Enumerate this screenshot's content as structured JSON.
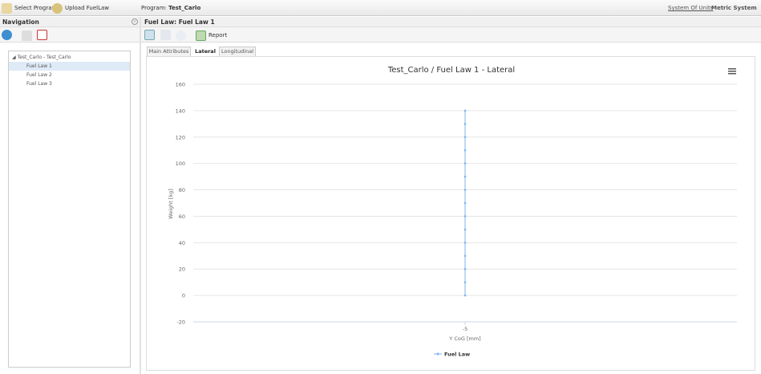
{
  "topbar": {
    "select_program": "Select Program",
    "upload_fuellaw": "Upload FuelLaw",
    "program_label": "Program:",
    "program_name": "Test_Carlo",
    "system_of_units": "System Of Units",
    "metric_system": "Metric System"
  },
  "navigation": {
    "title": "Navigation",
    "tree": {
      "root": "Test_Carlo - Test_Carlo",
      "items": [
        {
          "label": "Fuel Law 1",
          "selected": true
        },
        {
          "label": "Fuel Law 2"
        },
        {
          "label": "Fuel Law 3"
        }
      ]
    }
  },
  "main": {
    "header": "Fuel Law: Fuel Law 1",
    "report": "Report",
    "tabs": [
      {
        "label": "Main Attributes"
      },
      {
        "label": "Lateral",
        "active": true
      },
      {
        "label": "Longitudinal"
      }
    ]
  },
  "chart_data": {
    "type": "line",
    "title": "Test_Carlo / Fuel Law 1 - Lateral",
    "xlabel": "Y CoG [mm]",
    "ylabel": "Weight [kg]",
    "ylim": [
      -20,
      160
    ],
    "yticks": [
      -20,
      0,
      20,
      40,
      60,
      80,
      100,
      120,
      140,
      160
    ],
    "xticks": [
      "-5"
    ],
    "grid": true,
    "legend": "bottom-center",
    "series": [
      {
        "name": "Fuel Law",
        "color": "#7cb5ec",
        "x": [
          -5,
          -5,
          -5,
          -5,
          -5,
          -5,
          -5,
          -5,
          -5,
          -5,
          -5,
          -5,
          -5,
          -5,
          -5
        ],
        "y": [
          0,
          10,
          20,
          30,
          40,
          50,
          60,
          70,
          80,
          90,
          100,
          110,
          120,
          130,
          140
        ]
      }
    ]
  }
}
